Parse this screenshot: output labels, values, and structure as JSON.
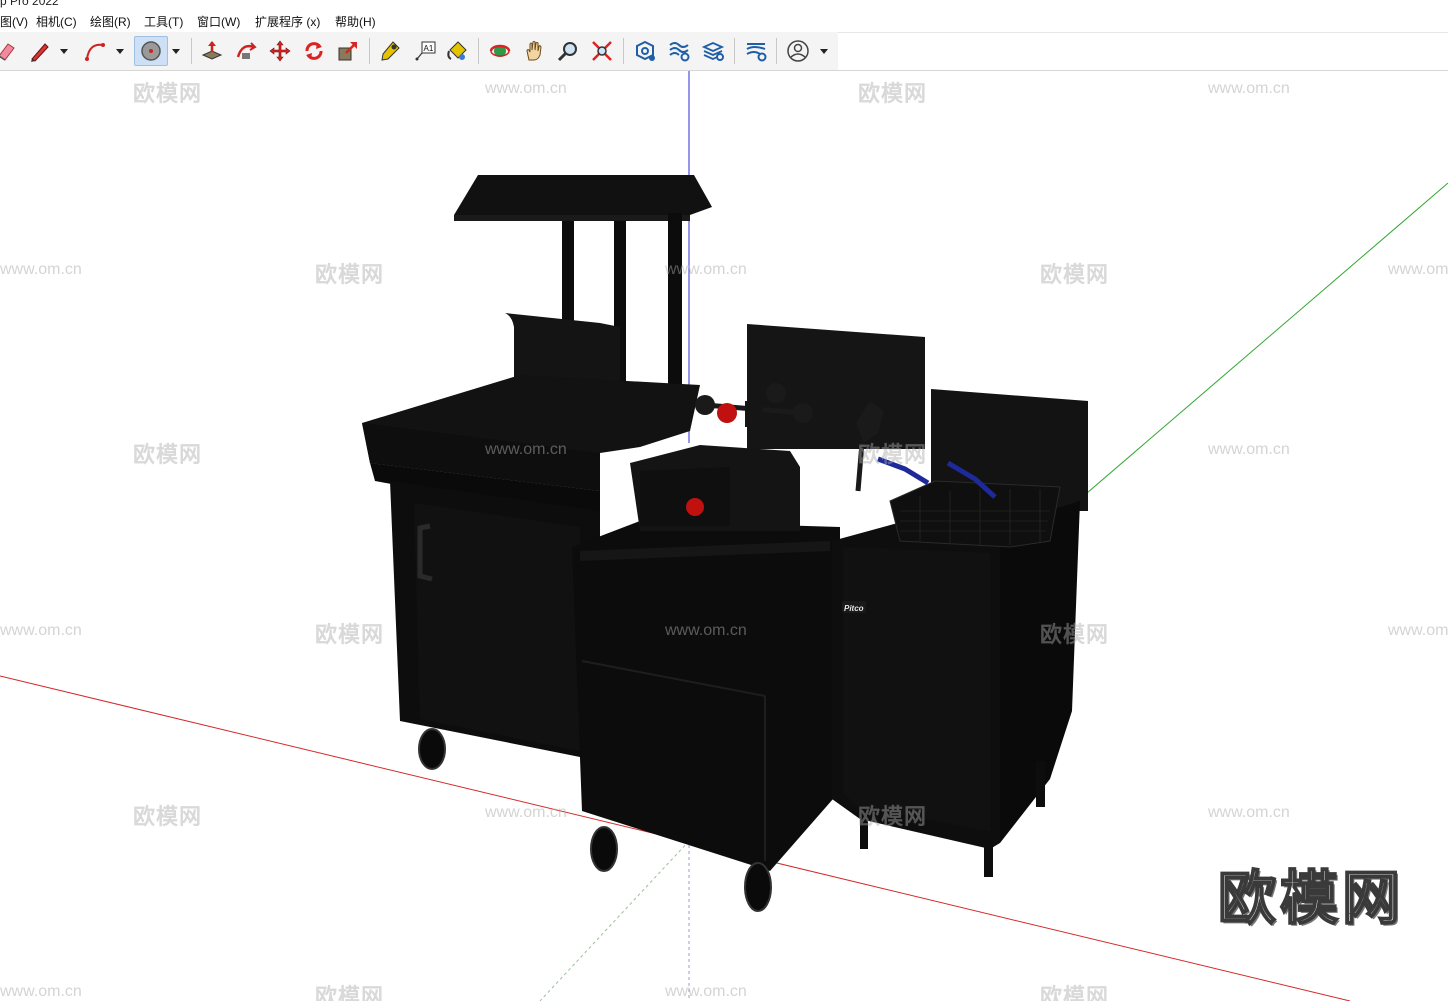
{
  "window": {
    "title": "p Pro 2022"
  },
  "menu": {
    "items": [
      {
        "label": "图(V)"
      },
      {
        "label": "相机(C)"
      },
      {
        "label": "绘图(R)"
      },
      {
        "label": "工具(T)"
      },
      {
        "label": "窗口(W)"
      },
      {
        "label": "扩展程序 (x)"
      },
      {
        "label": "帮助(H)"
      }
    ]
  },
  "toolbar": {
    "tools": [
      {
        "icon": "eraser-icon"
      },
      {
        "icon": "pencil-line-icon"
      },
      {
        "icon": "arc-icon"
      },
      {
        "icon": "circle-icon"
      },
      {
        "icon": "push-pull-icon"
      },
      {
        "icon": "follow-me-icon"
      },
      {
        "icon": "move-icon"
      },
      {
        "icon": "rotate-icon"
      },
      {
        "icon": "scale-icon"
      },
      {
        "icon": "tape-measure-icon"
      },
      {
        "icon": "text-icon",
        "label": "A1"
      },
      {
        "icon": "paint-bucket-icon"
      },
      {
        "icon": "orbit-icon"
      },
      {
        "icon": "pan-icon"
      },
      {
        "icon": "zoom-icon"
      },
      {
        "icon": "zoom-extents-icon"
      },
      {
        "icon": "component-settings-icon"
      },
      {
        "icon": "materials-settings-icon"
      },
      {
        "icon": "layers-settings-icon"
      },
      {
        "icon": "styles-settings-icon"
      },
      {
        "icon": "account-icon"
      }
    ]
  },
  "viewport": {
    "watermarks": {
      "brand_text": "欧模网",
      "url_text": "www.om.cn"
    },
    "equipment_label": "Pitco",
    "logo_text": "欧模网",
    "colors": {
      "axis_red": "#d42a2a",
      "axis_green": "#2fa62f",
      "axis_blue": "#2d2dd8",
      "model_fill": "#0f0f0f",
      "accent_red": "#c01010",
      "handle_blue": "#1e2a9a"
    }
  }
}
